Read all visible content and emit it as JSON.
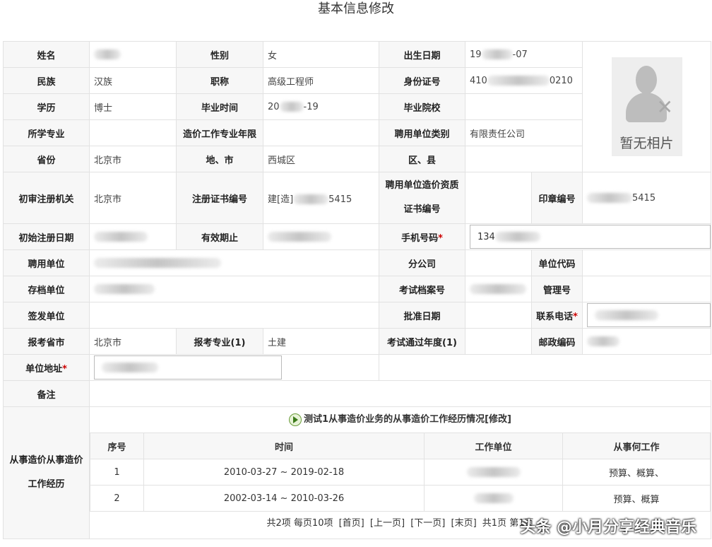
{
  "page_title": "基本信息修改",
  "labels": {
    "name": "姓名",
    "gender": "性别",
    "birth_date": "出生日期",
    "ethnicity": "民族",
    "title": "职称",
    "id_number": "身份证号",
    "education": "学历",
    "graduation_time": "毕业时间",
    "graduation_school": "毕业院校",
    "major": "所学专业",
    "cost_years": "造价工作专业年限",
    "employer_type": "聘用单位类别",
    "province": "省份",
    "city": "地、市",
    "district": "区、县",
    "initial_authority": "初审注册机关",
    "cert_number": "注册证书编号",
    "employer_cert_line1": "聘用单位造价资质",
    "employer_cert_line2": "证书编号",
    "seal_number": "印章编号",
    "initial_reg_date": "初始注册日期",
    "valid_until": "有效期止",
    "mobile": "手机号码",
    "employer": "聘用单位",
    "branch": "分公司",
    "unit_code": "单位代码",
    "archive_unit": "存档单位",
    "exam_archive_no": "考试档案号",
    "mgmt_no": "管理号",
    "issuing_unit": "签发单位",
    "approval_date": "批准日期",
    "contact_phone": "联系电话",
    "exam_province": "报考省市",
    "exam_major": "报考专业(1)",
    "exam_pass_year": "考试通过年度(1)",
    "postal_code": "邮政编码",
    "unit_address": "单位地址",
    "remarks": "备注",
    "experience_line1": "从事造价从事造价",
    "experience_line2": "工作经历",
    "required_mark": "*"
  },
  "values": {
    "gender": "女",
    "birth_date_prefix": "19",
    "birth_date_suffix": "-07",
    "ethnicity": "汉族",
    "title": "高级工程师",
    "id_prefix": "410",
    "id_suffix": "0210",
    "education": "博士",
    "grad_prefix": "20",
    "grad_suffix": "-19",
    "employer_type": "有限责任公司",
    "province": "北京市",
    "city": "西城区",
    "initial_authority": "北京市",
    "cert_prefix": "建[造]",
    "cert_suffix": "5415",
    "seal_suffix": "5415",
    "mobile_prefix": "134",
    "exam_province": "北京市",
    "exam_major": "土建"
  },
  "photo": {
    "placeholder_text": "暂无相片",
    "icon": "no-photo-person-icon"
  },
  "experience": {
    "section_title": "测试1从事造价业务的从事造价工作经历情况[修改]",
    "columns": [
      "序号",
      "时间",
      "工作单位",
      "从事何工作"
    ],
    "rows": [
      {
        "no": "1",
        "time": "2010-03-27 ~ 2019-02-18",
        "work": "预算、概算、"
      },
      {
        "no": "2",
        "time": "2002-03-14 ~ 2010-03-26",
        "work": "预算、概算"
      }
    ],
    "pager": {
      "summary": "共2项 每页10项",
      "first": "[首页]",
      "prev": "[上一页]",
      "next": "[下一页]",
      "last": "[末页]",
      "pages": "共1页 第1页"
    }
  },
  "watermark": "头条 @小月分享经典音乐",
  "colors": {
    "required": "#cc0000",
    "label_bg": "#f7f7f7",
    "border": "#e2e2e2"
  }
}
